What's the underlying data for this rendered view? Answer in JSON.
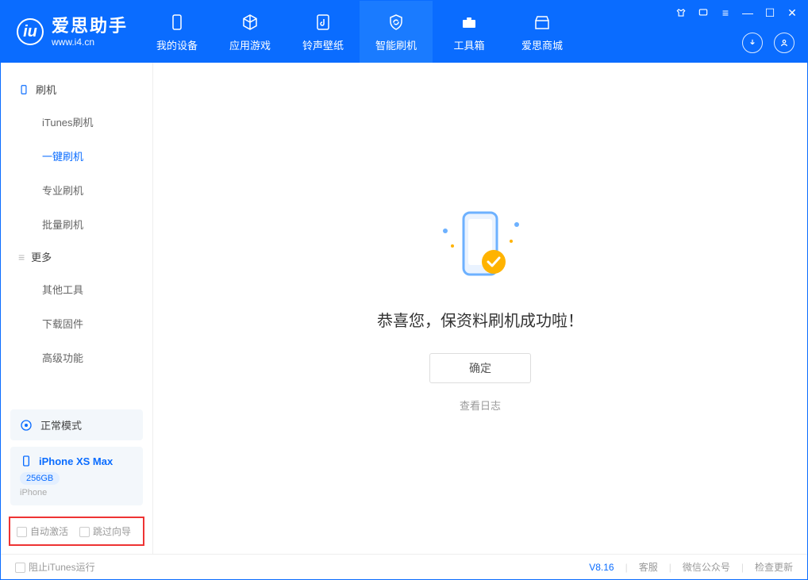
{
  "app": {
    "name": "爱思助手",
    "url": "www.i4.cn"
  },
  "nav": {
    "items": [
      {
        "label": "我的设备"
      },
      {
        "label": "应用游戏"
      },
      {
        "label": "铃声壁纸"
      },
      {
        "label": "智能刷机"
      },
      {
        "label": "工具箱"
      },
      {
        "label": "爱思商城"
      }
    ]
  },
  "sidebar": {
    "section1": "刷机",
    "items1": [
      "iTunes刷机",
      "一键刷机",
      "专业刷机",
      "批量刷机"
    ],
    "section2": "更多",
    "items2": [
      "其他工具",
      "下载固件",
      "高级功能"
    ]
  },
  "device": {
    "mode": "正常模式",
    "name": "iPhone XS Max",
    "capacity": "256GB",
    "type": "iPhone"
  },
  "checkboxes": {
    "auto_activate": "自动激活",
    "skip_guide": "跳过向导"
  },
  "main": {
    "success": "恭喜您，保资料刷机成功啦！",
    "ok": "确定",
    "view_log": "查看日志"
  },
  "status": {
    "block_itunes": "阻止iTunes运行",
    "version": "V8.16",
    "links": [
      "客服",
      "微信公众号",
      "检查更新"
    ]
  }
}
